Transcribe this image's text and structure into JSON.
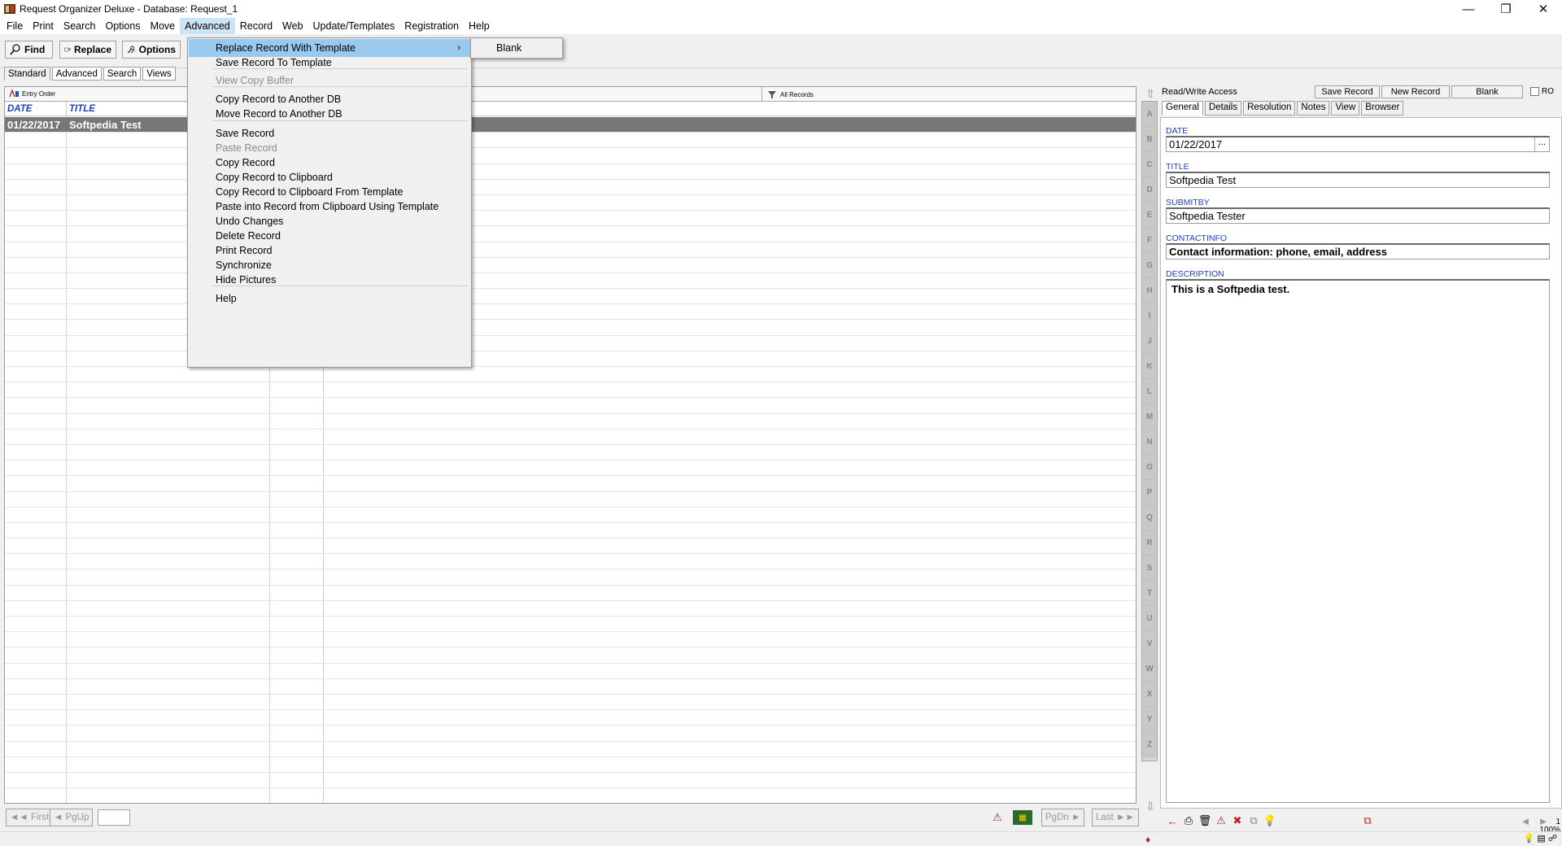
{
  "window": {
    "title": "Request Organizer Deluxe - Database: Request_1"
  },
  "menubar": [
    "File",
    "Print",
    "Search",
    "Options",
    "Move",
    "Advanced",
    "Record",
    "Web",
    "Update/Templates",
    "Registration",
    "Help"
  ],
  "toolbar": {
    "find": "Find",
    "replace": "Replace",
    "options": "Options"
  },
  "view_tabs": [
    "Standard",
    "Advanced",
    "Search",
    "Views"
  ],
  "list": {
    "sort_label": "Entry Order",
    "filter_label": "All Records",
    "columns": [
      "DATE",
      "TITLE"
    ],
    "rows": [
      {
        "date": "01/22/2017",
        "title": "Softpedia Test"
      }
    ]
  },
  "alpha": [
    "A",
    "B",
    "C",
    "D",
    "E",
    "F",
    "G",
    "H",
    "I",
    "J",
    "K",
    "L",
    "M",
    "N",
    "O",
    "P",
    "Q",
    "R",
    "S",
    "T",
    "U",
    "V",
    "W",
    "X",
    "Y",
    "Z"
  ],
  "record_panel": {
    "access": "Read/Write Access",
    "save_record": "Save Record",
    "new_record": "New Record",
    "blank": "Blank",
    "ro": "RO",
    "tabs": [
      "General",
      "Details",
      "Resolution",
      "Notes",
      "View",
      "Browser"
    ],
    "fields": {
      "date_label": "DATE",
      "date_value": "01/22/2017",
      "title_label": "TITLE",
      "title_value": "Softpedia Test",
      "submitby_label": "SUBMITBY",
      "submitby_value": "Softpedia Tester",
      "contactinfo_label": "CONTACTINFO",
      "contactinfo_value": "Contact information: phone, email, address",
      "description_label": "DESCRIPTION",
      "description_value": "This is a Softpedia test."
    },
    "dots": "..."
  },
  "nav": {
    "first": "First",
    "pgup": "PgUp",
    "pgdn": "PgDn",
    "last": "Last"
  },
  "zoom": {
    "top": "1",
    "value": "100%"
  },
  "advanced_menu": {
    "items": [
      {
        "label": "Replace Record With Template",
        "state": "highlighted",
        "submenu": true
      },
      {
        "label": "Save Record To Template"
      },
      {
        "label": "View Copy Buffer",
        "state": "disabled"
      },
      {
        "label": "Copy Record to Another DB"
      },
      {
        "label": "Move Record to Another DB"
      },
      {
        "label": "Save Record"
      },
      {
        "label": "Paste Record",
        "state": "disabled"
      },
      {
        "label": "Copy Record"
      },
      {
        "label": "Copy Record to Clipboard"
      },
      {
        "label": "Copy Record to Clipboard From Template"
      },
      {
        "label": "Paste into Record from Clipboard Using Template"
      },
      {
        "label": "Undo Changes"
      },
      {
        "label": "Delete Record"
      },
      {
        "label": "Print Record"
      },
      {
        "label": "Synchronize"
      },
      {
        "label": "Hide Pictures"
      },
      {
        "label": "Help"
      }
    ],
    "submenu_items": [
      "Blank"
    ]
  },
  "colors": {
    "highlight": "#99c9ef",
    "selected_row": "#777777",
    "label_blue": "#1f3fbf"
  }
}
